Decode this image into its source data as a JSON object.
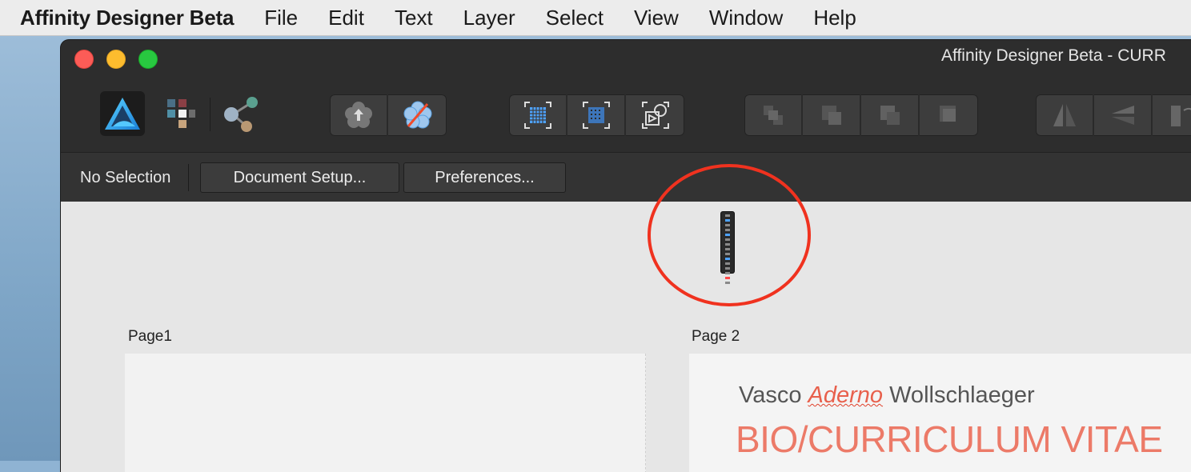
{
  "menubar": {
    "app_name": "Affinity Designer Beta",
    "menus": [
      "File",
      "Edit",
      "Text",
      "Layer",
      "Select",
      "View",
      "Window",
      "Help"
    ]
  },
  "window": {
    "title": "Affinity Designer Beta - CURR"
  },
  "context_bar": {
    "selection_status": "No Selection",
    "document_setup_label": "Document Setup...",
    "preferences_label": "Preferences..."
  },
  "canvas": {
    "page1_label": "Page1",
    "page2_label": "Page 2",
    "page2": {
      "name_first": "Vasco ",
      "name_middle": "Aderno",
      "name_last": " Wollschlaeger",
      "title": "BIO/CURRICULUM VITAE"
    }
  },
  "colors": {
    "accent_red": "#f0321f",
    "cv_title": "#ec7a68",
    "window_bg": "#2d2d2d"
  }
}
